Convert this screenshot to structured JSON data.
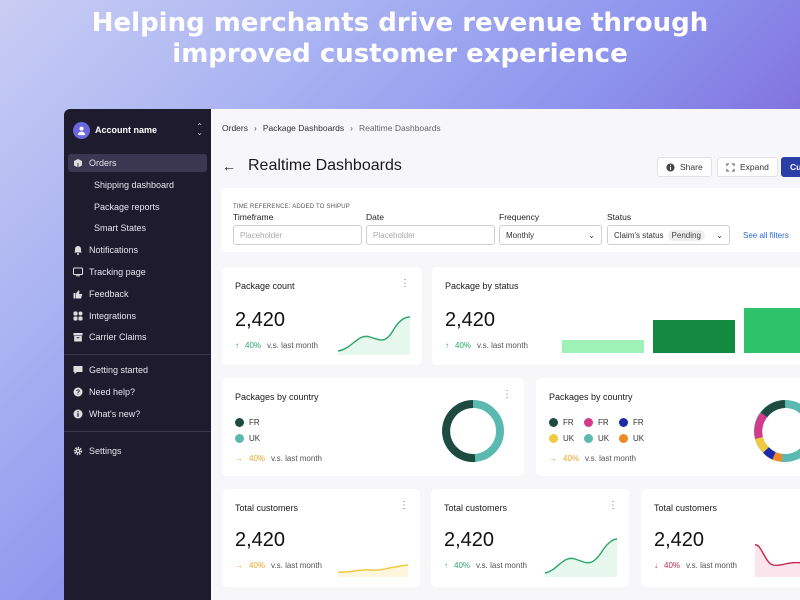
{
  "hero": {
    "line1": "Helping merchants drive revenue through",
    "line2": "improved customer experience"
  },
  "sidebar": {
    "account_name": "Account name",
    "items": [
      {
        "label": "Orders",
        "icon": "box-icon",
        "active": true
      },
      {
        "label": "Shipping dashboard",
        "sub": true
      },
      {
        "label": "Package reports",
        "sub": true
      },
      {
        "label": "Smart States",
        "sub": true
      },
      {
        "label": "Notifications",
        "icon": "bell-icon"
      },
      {
        "label": "Tracking page",
        "icon": "screen-icon"
      },
      {
        "label": "Feedback",
        "icon": "thumbs-up-icon"
      },
      {
        "label": "Integrations",
        "icon": "grid-icon"
      },
      {
        "label": "Carrier Claims",
        "icon": "archive-icon"
      }
    ],
    "bottom_items": [
      {
        "label": "Getting started",
        "icon": "chat-icon"
      },
      {
        "label": "Need help?",
        "icon": "question-icon"
      },
      {
        "label": "What's new?",
        "icon": "info-icon"
      }
    ],
    "settings": "Settings"
  },
  "breadcrumb": {
    "items": [
      "Orders",
      "Package Dashboards",
      "Realtime Dashboards"
    ]
  },
  "page": {
    "title": "Realtime Dashboards",
    "share": "Share",
    "expand": "Expand",
    "primary": "Cu"
  },
  "filters": {
    "reference": "TIME REFERENCE: ADDED TO SHIPUP",
    "timeframe": {
      "label": "Timeframe",
      "placeholder": "Placeholder"
    },
    "date": {
      "label": "Date",
      "placeholder": "Placeholder"
    },
    "frequency": {
      "label": "Frequency",
      "value": "Monthly"
    },
    "status": {
      "label": "Status",
      "value": "Claim's status",
      "pill": "Pending"
    },
    "see_all": "See all filters"
  },
  "cards": {
    "package_count": {
      "title": "Package count",
      "value": "2,420",
      "delta": "40%",
      "vs": "v.s. last month"
    },
    "package_status": {
      "title": "Package by status",
      "value": "2,420",
      "delta": "40%",
      "vs": "v.s. last month"
    },
    "country1": {
      "title": "Packages by country",
      "legend": [
        "FR",
        "UK"
      ],
      "delta": "40%",
      "vs": "v.s. last month"
    },
    "country2": {
      "title": "Packages by country",
      "legend": [
        "FR",
        "FR",
        "FR",
        "UK",
        "UK",
        "UK"
      ],
      "delta": "40%",
      "vs": "v.s. last month"
    },
    "cust1": {
      "title": "Total customers",
      "value": "2,420",
      "delta": "40%",
      "vs": "v.s. last month"
    },
    "cust2": {
      "title": "Total customers",
      "value": "2,420",
      "delta": "40%",
      "vs": "v.s. last month"
    },
    "cust3": {
      "title": "Total customers",
      "value": "2,420",
      "delta": "40%",
      "vs": "v.s. last month"
    }
  },
  "colors": {
    "green": "#2aa66a",
    "orange": "#e6a52a",
    "red": "#c3264e",
    "dark_teal": "#1e4a40",
    "teal": "#5bbab0",
    "magenta": "#d23a8c",
    "navy": "#1c2aa8",
    "yellow": "#f0c93e",
    "amber": "#f08a24"
  }
}
